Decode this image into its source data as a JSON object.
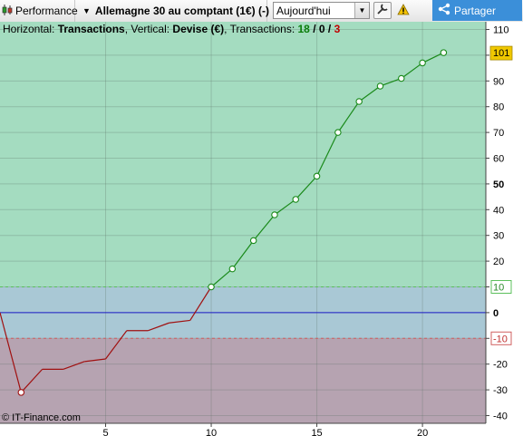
{
  "toolbar": {
    "performance_label": "Performance",
    "instrument_label": "Allemagne 30 au comptant (1€) (-)",
    "date_selected": "Aujourd'hui",
    "share_label": "Partager"
  },
  "legend": {
    "horizontal_prefix": "Horizontal: ",
    "horizontal_value": "Transactions",
    "vertical_prefix": ", Vertical: ",
    "vertical_value": "Devise (€)",
    "transactions_prefix": ", Transactions: ",
    "winners": "18",
    "sep1": " / ",
    "neutral": "0",
    "sep2": " / ",
    "losers": "3"
  },
  "copyright": "© IT-Finance.com",
  "colors": {
    "profit_zone": "#a4dcc0",
    "neutral_zone": "#a9c8d5",
    "loss_zone": "#b6a3b1",
    "profit_line": "#1a8a1a",
    "loss_line": "#a01010",
    "zero_line": "#1c1cc8",
    "last_value_badge": "#f0c800"
  },
  "chart_data": {
    "type": "line",
    "xlabel": "Transactions",
    "ylabel": "Devise (€)",
    "x": [
      0,
      1,
      2,
      3,
      4,
      5,
      6,
      7,
      8,
      9,
      10,
      11,
      12,
      13,
      14,
      15,
      16,
      17,
      18,
      19,
      20,
      21
    ],
    "y": [
      0,
      -31,
      -22,
      -22,
      -19,
      -18,
      -7,
      -7,
      -4,
      -3,
      10,
      17,
      28,
      38,
      44,
      53,
      70,
      82,
      88,
      91,
      97,
      101
    ],
    "xlim": [
      0,
      23
    ],
    "ylim": [
      -43,
      113
    ],
    "x_ticks": [
      5,
      10,
      15,
      20
    ],
    "y_ticks": [
      110,
      100,
      90,
      80,
      70,
      60,
      50,
      40,
      30,
      20,
      10,
      0,
      -10,
      -20,
      -30,
      -40
    ],
    "y_bold_ticks": [
      50,
      0
    ],
    "threshold_upper": 10,
    "threshold_lower": -10,
    "last_value": "101",
    "grid": true
  }
}
